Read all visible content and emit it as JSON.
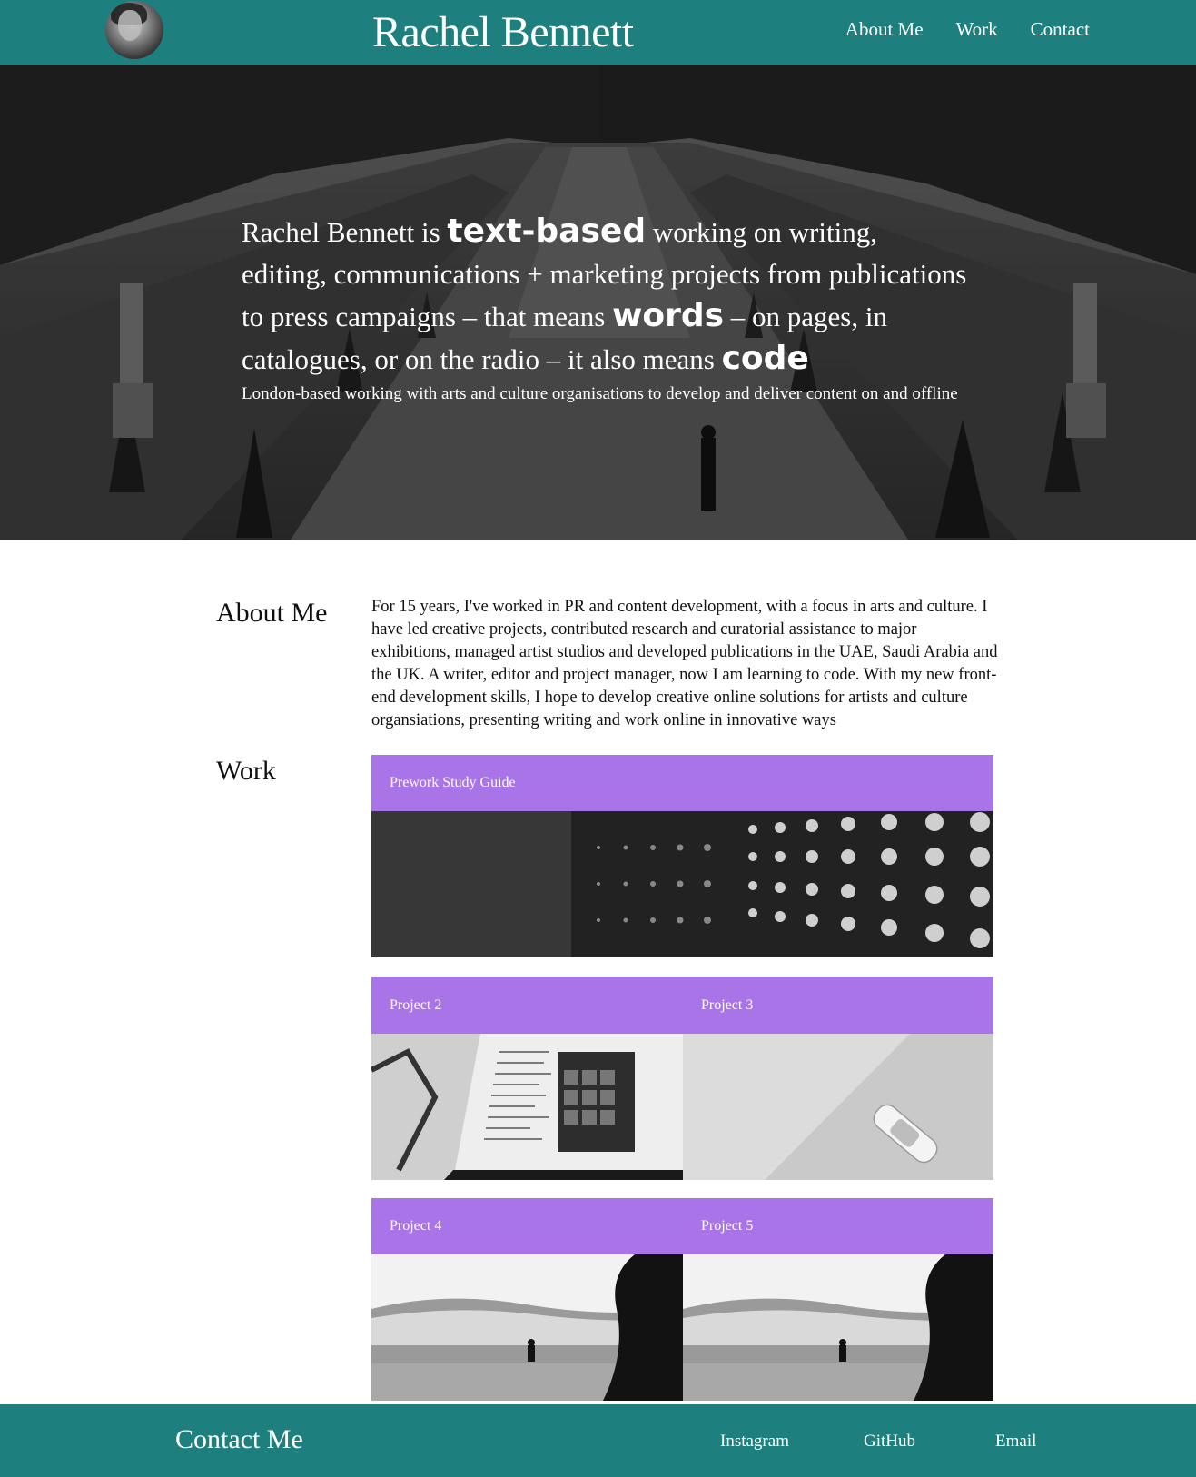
{
  "header": {
    "brand": "Rachel Bennett",
    "avatar_icon": "profile-photo",
    "nav": [
      "About Me",
      "Work",
      "Contact"
    ],
    "background": "#1e7f7f"
  },
  "hero": {
    "text_1": "Rachel Bennett is ",
    "emphasis_1": "text-based",
    "text_2": " working on writing, editing, communications + marketing projects from publications to press campaigns – that means ",
    "emphasis_2": "words",
    "text_3": " – on pages, in catalogues, or on the radio – it also means ",
    "emphasis_3": "code",
    "subtitle": "London-based working with arts and culture organisations to develop and deliver content on and offline"
  },
  "about": {
    "heading": "About Me",
    "body": "For 15 years, I've worked in PR and content development, with a focus in arts and culture. I have led creative projects, contributed research and curatorial assistance to major exhibitions, managed artist studios and developed publications in the UAE, Saudi Arabia and the UK. A writer, editor and project manager, now I am learning to code. With my new front-end development skills, I hope to develop creative online solutions for artists and culture organsiations, presenting writing and work online in innovative ways"
  },
  "work": {
    "heading": "Work",
    "accent": "#a974e8",
    "projects": [
      {
        "title": "Prework Study Guide",
        "image": "led-wall-photo"
      },
      {
        "title": "Project 2",
        "image": "laptop-code-photo"
      },
      {
        "title": "Project 3",
        "image": "toy-car-photo"
      },
      {
        "title": "Project 4",
        "image": "surf-wave-photo"
      },
      {
        "title": "Project 5",
        "image": "surf-wave-photo"
      }
    ]
  },
  "footer": {
    "title": "Contact Me",
    "links": [
      "Instagram",
      "GitHub",
      "Email"
    ],
    "background": "#1e7f7f"
  }
}
